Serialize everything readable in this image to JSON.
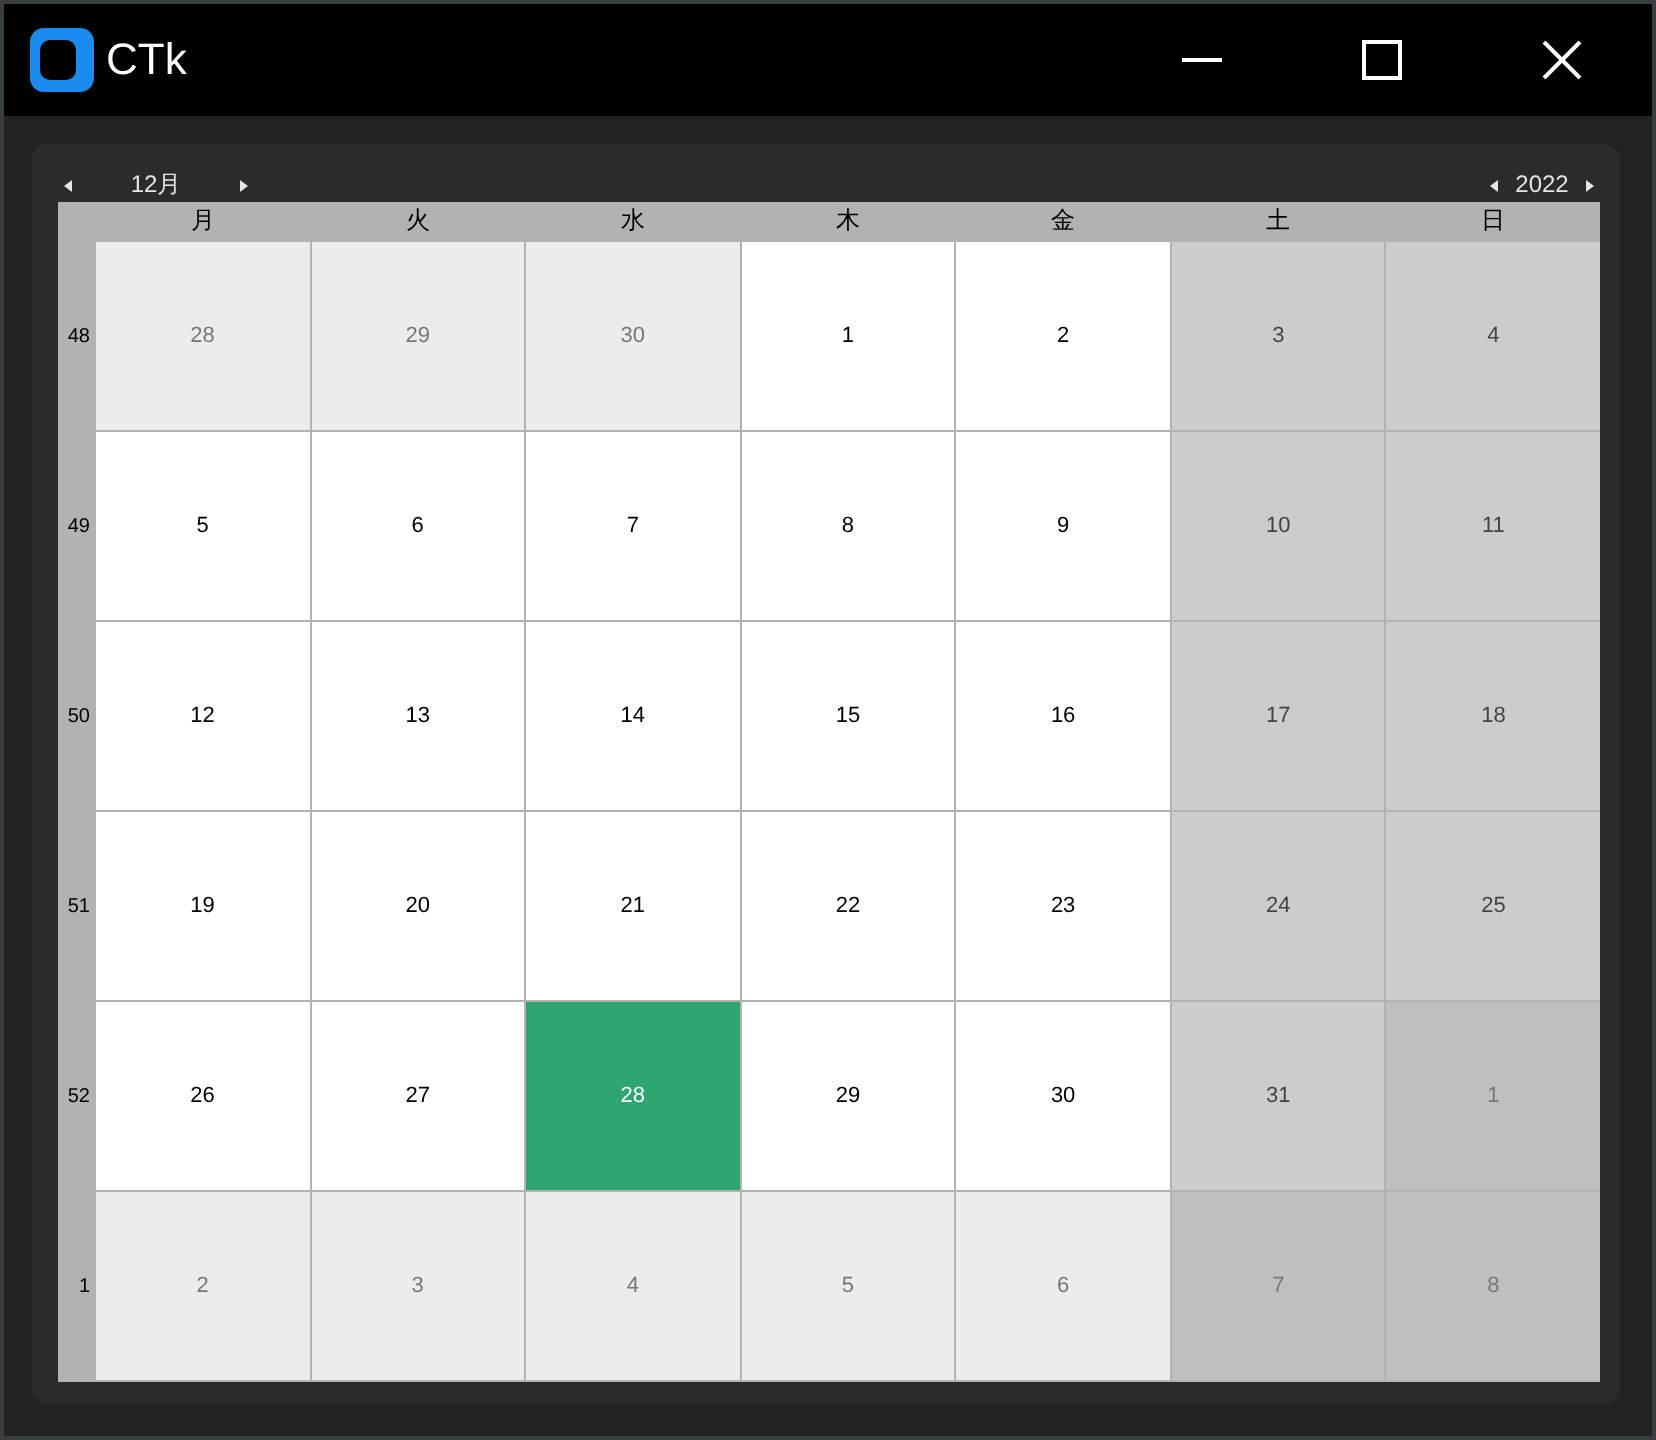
{
  "window": {
    "title": "CTk"
  },
  "calendar": {
    "month": "12月",
    "year": "2022",
    "weekdays": [
      "月",
      "火",
      "水",
      "木",
      "金",
      "土",
      "日"
    ],
    "weeks": [
      {
        "number": "48",
        "days": [
          {
            "day": "28",
            "in_month": false,
            "weekend": false,
            "selected": false
          },
          {
            "day": "29",
            "in_month": false,
            "weekend": false,
            "selected": false
          },
          {
            "day": "30",
            "in_month": false,
            "weekend": false,
            "selected": false
          },
          {
            "day": "1",
            "in_month": true,
            "weekend": false,
            "selected": false
          },
          {
            "day": "2",
            "in_month": true,
            "weekend": false,
            "selected": false
          },
          {
            "day": "3",
            "in_month": true,
            "weekend": true,
            "selected": false
          },
          {
            "day": "4",
            "in_month": true,
            "weekend": true,
            "selected": false
          }
        ]
      },
      {
        "number": "49",
        "days": [
          {
            "day": "5",
            "in_month": true,
            "weekend": false,
            "selected": false
          },
          {
            "day": "6",
            "in_month": true,
            "weekend": false,
            "selected": false
          },
          {
            "day": "7",
            "in_month": true,
            "weekend": false,
            "selected": false
          },
          {
            "day": "8",
            "in_month": true,
            "weekend": false,
            "selected": false
          },
          {
            "day": "9",
            "in_month": true,
            "weekend": false,
            "selected": false
          },
          {
            "day": "10",
            "in_month": true,
            "weekend": true,
            "selected": false
          },
          {
            "day": "11",
            "in_month": true,
            "weekend": true,
            "selected": false
          }
        ]
      },
      {
        "number": "50",
        "days": [
          {
            "day": "12",
            "in_month": true,
            "weekend": false,
            "selected": false
          },
          {
            "day": "13",
            "in_month": true,
            "weekend": false,
            "selected": false
          },
          {
            "day": "14",
            "in_month": true,
            "weekend": false,
            "selected": false
          },
          {
            "day": "15",
            "in_month": true,
            "weekend": false,
            "selected": false
          },
          {
            "day": "16",
            "in_month": true,
            "weekend": false,
            "selected": false
          },
          {
            "day": "17",
            "in_month": true,
            "weekend": true,
            "selected": false
          },
          {
            "day": "18",
            "in_month": true,
            "weekend": true,
            "selected": false
          }
        ]
      },
      {
        "number": "51",
        "days": [
          {
            "day": "19",
            "in_month": true,
            "weekend": false,
            "selected": false
          },
          {
            "day": "20",
            "in_month": true,
            "weekend": false,
            "selected": false
          },
          {
            "day": "21",
            "in_month": true,
            "weekend": false,
            "selected": false
          },
          {
            "day": "22",
            "in_month": true,
            "weekend": false,
            "selected": false
          },
          {
            "day": "23",
            "in_month": true,
            "weekend": false,
            "selected": false
          },
          {
            "day": "24",
            "in_month": true,
            "weekend": true,
            "selected": false
          },
          {
            "day": "25",
            "in_month": true,
            "weekend": true,
            "selected": false
          }
        ]
      },
      {
        "number": "52",
        "days": [
          {
            "day": "26",
            "in_month": true,
            "weekend": false,
            "selected": false
          },
          {
            "day": "27",
            "in_month": true,
            "weekend": false,
            "selected": false
          },
          {
            "day": "28",
            "in_month": true,
            "weekend": false,
            "selected": true
          },
          {
            "day": "29",
            "in_month": true,
            "weekend": false,
            "selected": false
          },
          {
            "day": "30",
            "in_month": true,
            "weekend": false,
            "selected": false
          },
          {
            "day": "31",
            "in_month": true,
            "weekend": true,
            "selected": false
          },
          {
            "day": "1",
            "in_month": false,
            "weekend": true,
            "selected": false
          }
        ]
      },
      {
        "number": "1",
        "days": [
          {
            "day": "2",
            "in_month": false,
            "weekend": false,
            "selected": false
          },
          {
            "day": "3",
            "in_month": false,
            "weekend": false,
            "selected": false
          },
          {
            "day": "4",
            "in_month": false,
            "weekend": false,
            "selected": false
          },
          {
            "day": "5",
            "in_month": false,
            "weekend": false,
            "selected": false
          },
          {
            "day": "6",
            "in_month": false,
            "weekend": false,
            "selected": false
          },
          {
            "day": "7",
            "in_month": false,
            "weekend": true,
            "selected": false
          },
          {
            "day": "8",
            "in_month": false,
            "weekend": true,
            "selected": false
          }
        ]
      }
    ]
  }
}
